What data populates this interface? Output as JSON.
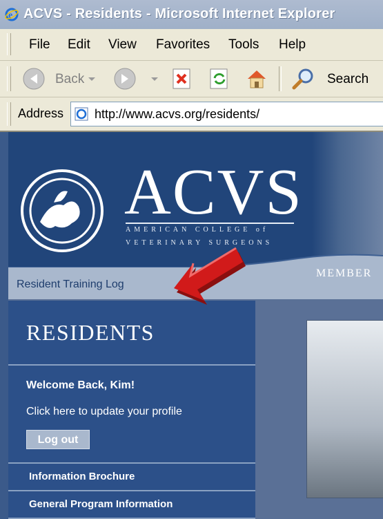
{
  "window": {
    "title": "ACVS - Residents - Microsoft Internet Explorer"
  },
  "menu": [
    "File",
    "Edit",
    "View",
    "Favorites",
    "Tools",
    "Help"
  ],
  "toolbar": {
    "back_label": "Back",
    "search_label": "Search"
  },
  "address": {
    "label": "Address",
    "url": "http://www.acvs.org/residents/"
  },
  "site": {
    "logo_text": "ACVS",
    "logo_line1": "AMERICAN COLLEGE of",
    "logo_line2": "VETERINARY SURGEONS",
    "nav_link": "Resident Training Log",
    "nav_members": "MEMBER"
  },
  "sidebar": {
    "heading": "RESIDENTS",
    "welcome": "Welcome Back, Kim!",
    "update_profile": "Click here to update your profile",
    "logout_label": "Log out",
    "items": [
      "Information Brochure",
      "General Program Information"
    ]
  },
  "colors": {
    "header_blue": "#21457a",
    "sidebar_blue": "#2c5089",
    "annotation_red": "#d11a1a"
  }
}
